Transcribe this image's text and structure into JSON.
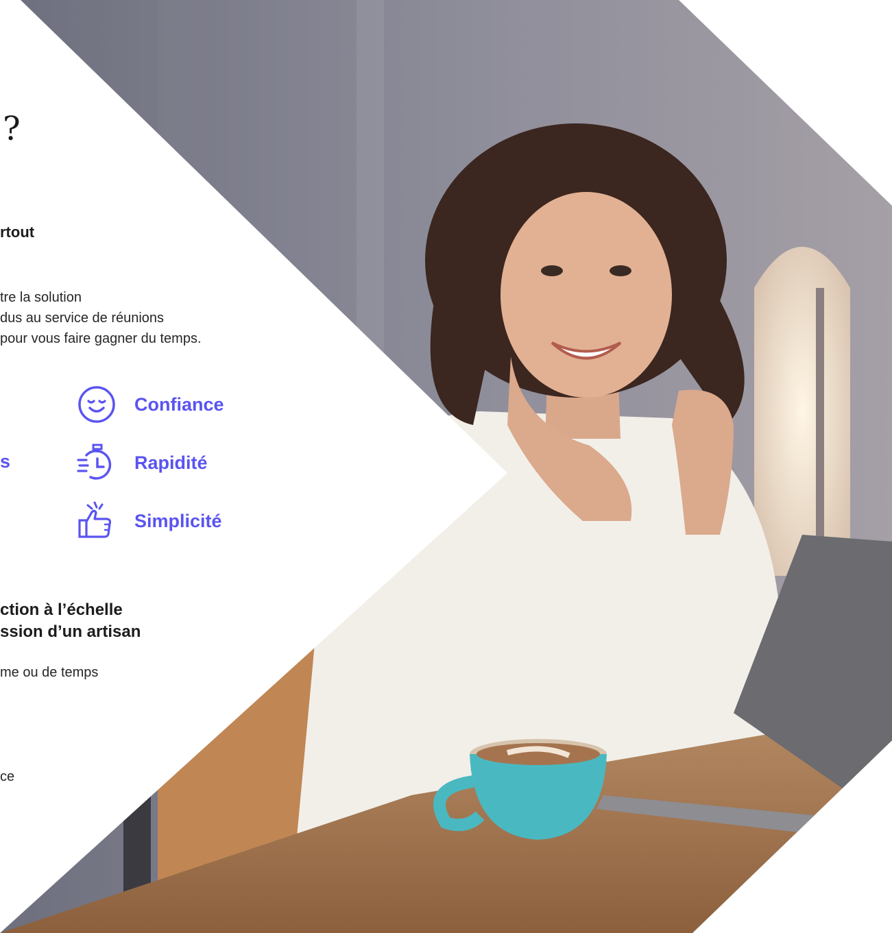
{
  "hero": {
    "question_mark": "?",
    "heading_top": "rtout",
    "intro_lines": [
      "tre la solution",
      "dus au service de réunions",
      "pour vous faire gagner du temps."
    ],
    "cut_feature_letter": "s",
    "features": [
      {
        "label": "Confiance",
        "icon": "smile-icon"
      },
      {
        "label": "Rapidité",
        "icon": "stopwatch-icon"
      },
      {
        "label": "Simplicité",
        "icon": "thumbs-up-icon"
      }
    ],
    "heading_2_lines": [
      "ction à l’échelle",
      "ssion d’un artisan"
    ],
    "para_2": "me ou de temps",
    "para_3": "ce"
  },
  "colors": {
    "accent": "#5a54f0",
    "text": "#1c1c1c"
  }
}
